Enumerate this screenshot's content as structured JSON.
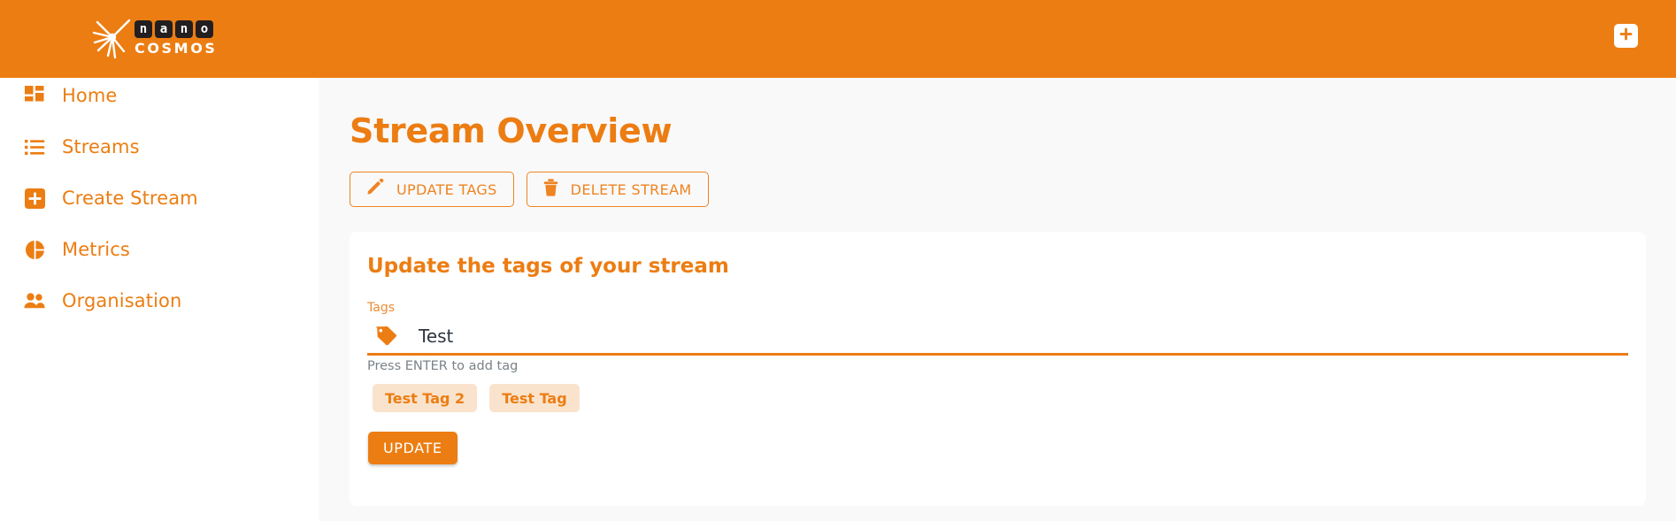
{
  "colors": {
    "brand_orange": "#ec7d12",
    "brand_orange_light": "#ee8422",
    "chip_bg": "#fae3cd",
    "page_bg": "#f9f9f9",
    "card_bg": "#ffffff",
    "logo_dark": "#231f20",
    "hint_text": "#7a8288"
  },
  "header": {
    "logo": {
      "icon_name": "nanocosmos-burst-logo",
      "chars": [
        "n",
        "a",
        "n",
        "o"
      ],
      "wordmark": "COSMOS"
    },
    "add_button": {
      "icon_name": "plus-icon",
      "label": "+"
    }
  },
  "sidebar": {
    "items": [
      {
        "label": "Home",
        "icon": "grid-dashboard-icon"
      },
      {
        "label": "Streams",
        "icon": "list-icon"
      },
      {
        "label": "Create Stream",
        "icon": "plus-square-icon"
      },
      {
        "label": "Metrics",
        "icon": "pie-chart-icon"
      },
      {
        "label": "Organisation",
        "icon": "people-icon"
      }
    ]
  },
  "main": {
    "page_title": "Stream Overview",
    "actions": [
      {
        "label": "UPDATE TAGS",
        "icon": "pencil-icon"
      },
      {
        "label": "DELETE STREAM",
        "icon": "trash-icon"
      }
    ],
    "card": {
      "title": "Update the tags of your stream",
      "field_label": "Tags",
      "input": {
        "icon": "tag-icon",
        "value": "Test",
        "placeholder": ""
      },
      "hint": "Press ENTER to add tag",
      "chips": [
        {
          "label": "Test Tag 2"
        },
        {
          "label": "Test Tag"
        }
      ],
      "submit_label": "UPDATE"
    }
  }
}
